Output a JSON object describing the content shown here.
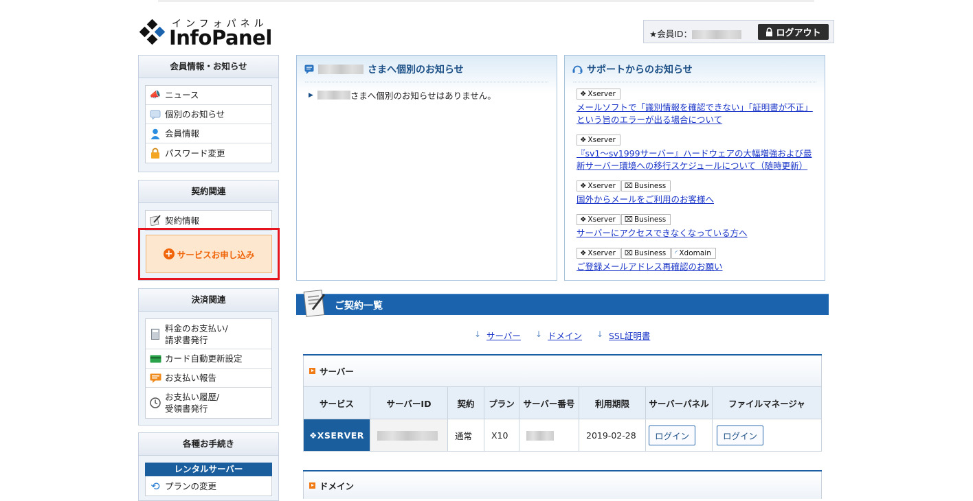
{
  "header": {
    "logo_kana": "インフォパネル",
    "logo_name": "InfoPanel",
    "member_id_label": "★会員ID：",
    "logout_label": "ログアウト"
  },
  "sidebar": {
    "member": {
      "title": "会員情報・お知らせ",
      "items": [
        {
          "label": "ニュース",
          "icon": "megaphone-icon"
        },
        {
          "label": "個別のお知らせ",
          "icon": "speech-bubble-icon"
        },
        {
          "label": "会員情報",
          "icon": "person-icon"
        },
        {
          "label": "パスワード変更",
          "icon": "lock-icon"
        }
      ]
    },
    "contract": {
      "title": "契約関連",
      "items": [
        {
          "label": "契約情報",
          "icon": "document-pen-icon"
        }
      ],
      "apply_label": "サービスお申し込み"
    },
    "payment": {
      "title": "決済関連",
      "items": [
        {
          "label": "料金のお支払い/\n請求書発行",
          "icon": "calculator-icon"
        },
        {
          "label": "カード自動更新設定",
          "icon": "credit-card-icon"
        },
        {
          "label": "お支払い報告",
          "icon": "report-icon"
        },
        {
          "label": "お支払い履歴/\n受領書発行",
          "icon": "clock-icon"
        }
      ]
    },
    "procedures": {
      "title": "各種お手続き",
      "rental_title": "レンタルサーバー",
      "items": [
        {
          "label": "プランの変更",
          "icon": "refresh-arrows-icon"
        }
      ]
    }
  },
  "personal_notice": {
    "title_suffix": "さまへ個別のお知らせ",
    "empty_message_suffix": "さまへ個別のお知らせはありません。"
  },
  "support_notice": {
    "title": "サポートからのお知らせ",
    "items": [
      {
        "tags": [
          "Xserver"
        ],
        "link": "メールソフトで「識別情報を確認できない」「証明書が不正」という旨のエラーが出る場合について"
      },
      {
        "tags": [
          "Xserver"
        ],
        "link": "『sv1～sv1999サーバー』ハードウェアの大幅増強および最新サーバー環境への移行スケジュールについて（随時更新）"
      },
      {
        "tags": [
          "Xserver",
          "Business"
        ],
        "link": "国外からメールをご利用のお客様へ"
      },
      {
        "tags": [
          "Xserver",
          "Business"
        ],
        "link": "サーバーにアクセスできなくなっている方へ"
      },
      {
        "tags": [
          "Xserver",
          "Business",
          "Xdomain"
        ],
        "link": "ご登録メールアドレス再確認のお願い"
      }
    ]
  },
  "contracts": {
    "title": "ご契約一覧",
    "anchors": [
      "サーバー",
      "ドメイン",
      "SSL証明書"
    ],
    "server_section": {
      "title": "サーバー",
      "columns": [
        "サービス",
        "サーバーID",
        "契約",
        "プラン",
        "サーバー番号",
        "利用期限",
        "サーバーパネル",
        "ファイルマネージャ"
      ],
      "row": {
        "service": "XSERVER",
        "contract": "通常",
        "plan": "X10",
        "expiry": "2019-02-28",
        "panel_login": "ログイン",
        "fm_login": "ログイン"
      }
    },
    "domain_section": {
      "title": "ドメイン"
    }
  },
  "colors": {
    "brand_blue": "#1b5e9e",
    "accent_orange": "#f0650a",
    "highlight_red": "#e5141e",
    "link": "#1a35c8"
  }
}
